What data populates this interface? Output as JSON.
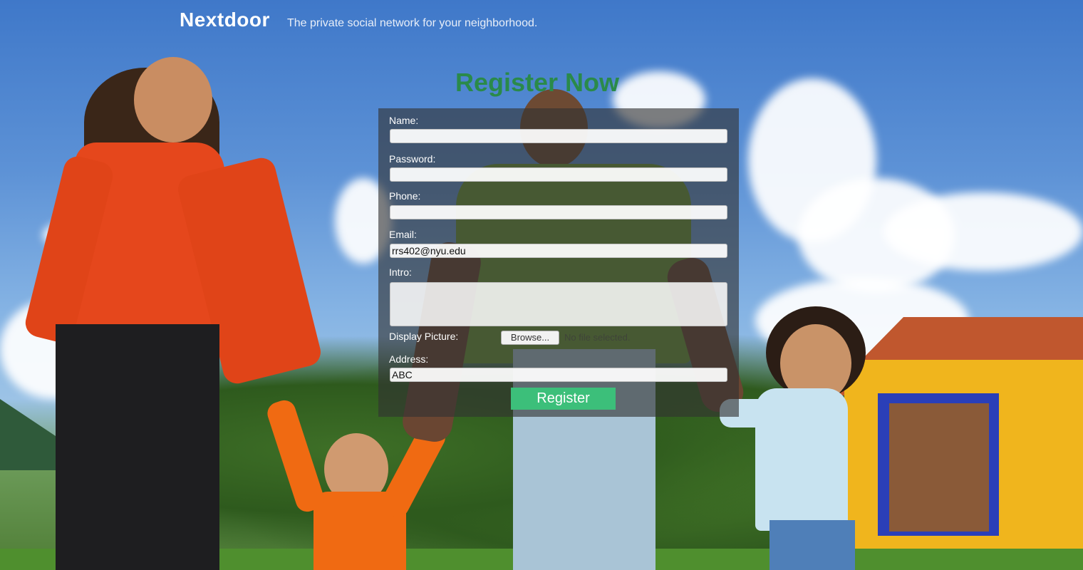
{
  "header": {
    "brand": "Nextdoor",
    "tagline": "The private social network for your neighborhood."
  },
  "form": {
    "title": "Register Now",
    "fields": {
      "name": {
        "label": "Name:",
        "value": ""
      },
      "password": {
        "label": "Password:",
        "value": ""
      },
      "phone": {
        "label": "Phone:",
        "value": ""
      },
      "email": {
        "label": "Email:",
        "value": "rrs402@nyu.edu"
      },
      "intro": {
        "label": "Intro:",
        "value": ""
      },
      "display_picture": {
        "label": "Display Picture:",
        "browse_label": "Browse...",
        "file_status": "No file selected."
      },
      "address": {
        "label": "Address:",
        "value": "ABC"
      }
    },
    "submit_label": "Register"
  },
  "colors": {
    "title": "#2a8a4a",
    "submit": "#3cbf7a",
    "panel": "rgba(50,50,50,0.62)"
  }
}
